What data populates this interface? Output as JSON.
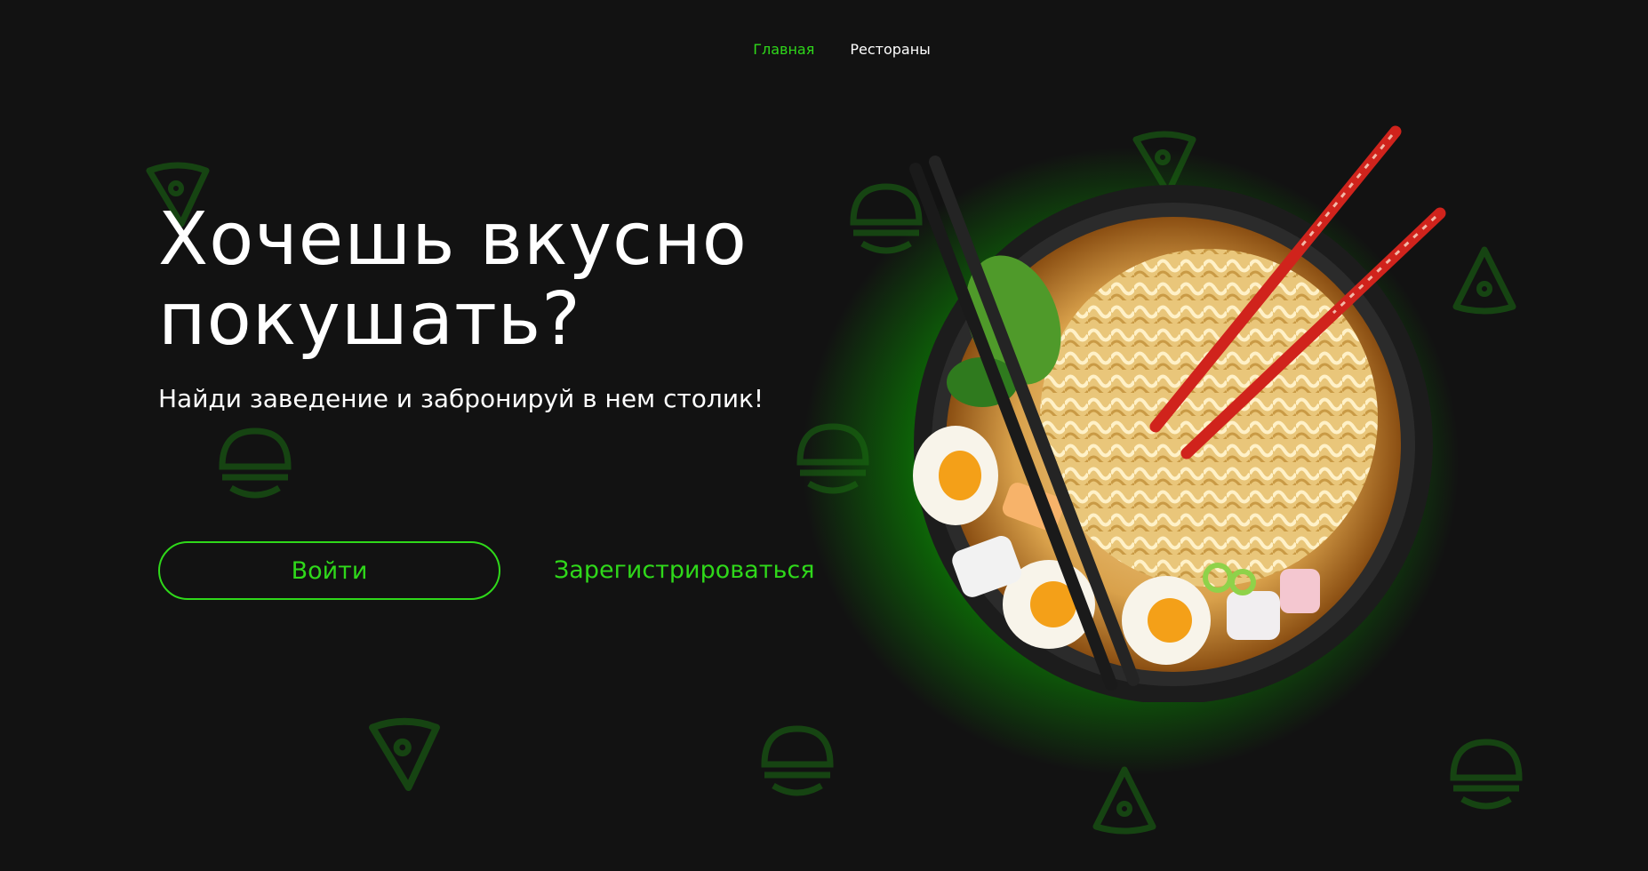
{
  "nav": {
    "items": [
      {
        "label": "Главная",
        "active": true
      },
      {
        "label": "Рестораны",
        "active": false
      }
    ]
  },
  "hero": {
    "headline_line1": "Хочешь вкусно",
    "headline_line2": "покушать?",
    "subtitle": "Найди заведение и забронируй в нем столик!",
    "login_label": "Войти",
    "register_label": "Зарегистрироваться",
    "image": "ramen-bowl-with-chopsticks"
  },
  "background_icons": [
    "pizza-slice-icon",
    "burger-icon"
  ],
  "colors": {
    "background": "#121212",
    "accent": "#2fd81a",
    "text": "#ffffff"
  }
}
